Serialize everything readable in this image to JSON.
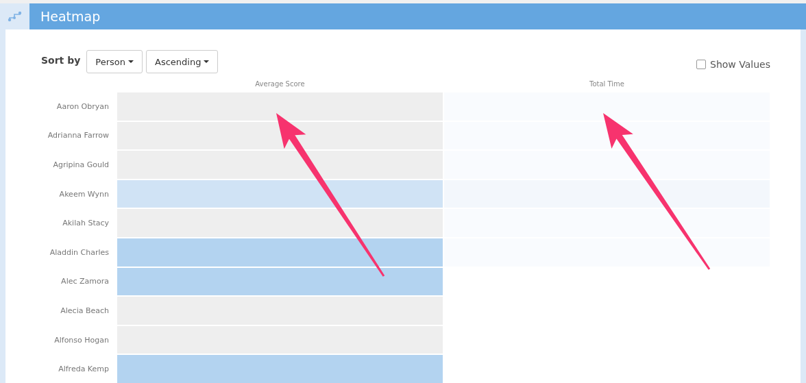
{
  "header": {
    "title": "Heatmap"
  },
  "toolbar": {
    "sort_label": "Sort by",
    "sort_field": "Person",
    "sort_order": "Ascending",
    "show_values": {
      "label": "Show Values",
      "checked": false
    }
  },
  "heatmap": {
    "columns": [
      "Average Score",
      "Total Time"
    ],
    "rows": [
      {
        "name": "Aaron Obryan",
        "cells": [
          {
            "color": "#eeeeee"
          },
          {
            "color": "#f9fbfe"
          }
        ]
      },
      {
        "name": "Adrianna Farrow",
        "cells": [
          {
            "color": "#eeeeee"
          },
          {
            "color": "#f9fbfe"
          }
        ]
      },
      {
        "name": "Agripina Gould",
        "cells": [
          {
            "color": "#eeeeee"
          },
          {
            "color": "#f9fbfe"
          }
        ]
      },
      {
        "name": "Akeem Wynn",
        "cells": [
          {
            "color": "#d0e3f5"
          },
          {
            "color": "#f3f7fc"
          }
        ]
      },
      {
        "name": "Akilah Stacy",
        "cells": [
          {
            "color": "#eeeeee"
          },
          {
            "color": "#f9fbfe"
          }
        ]
      },
      {
        "name": "Aladdin Charles",
        "cells": [
          {
            "color": "#b3d3f0"
          },
          {
            "color": "#f9fbfe"
          }
        ]
      },
      {
        "name": "Alec Zamora",
        "cells": [
          {
            "color": "#b3d3f0"
          }
        ]
      },
      {
        "name": "Alecia Beach",
        "cells": [
          {
            "color": "#eeeeee"
          }
        ]
      },
      {
        "name": "Alfonso Hogan",
        "cells": [
          {
            "color": "#eeeeee"
          }
        ]
      },
      {
        "name": "Alfreda Kemp",
        "cells": [
          {
            "color": "#b3d3f0"
          }
        ]
      }
    ]
  }
}
